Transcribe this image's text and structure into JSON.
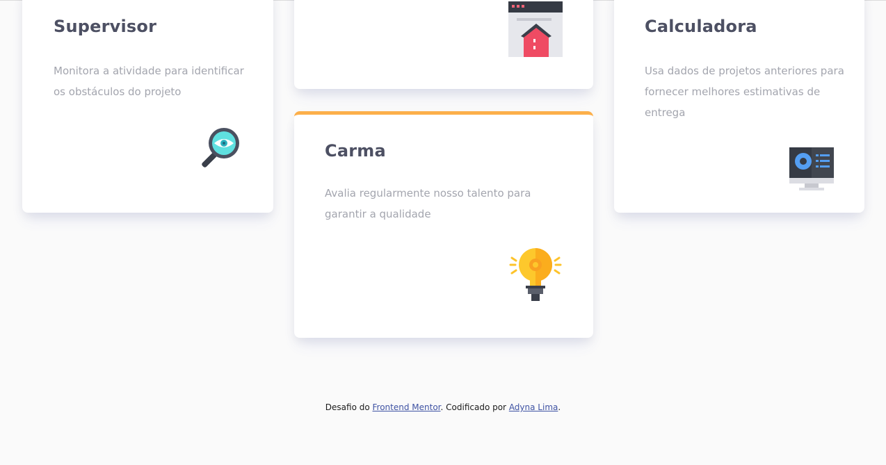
{
  "cards": {
    "supervisor": {
      "title": "Supervisor",
      "description": "Monitora a atividade para identificar os obstáculos do projeto",
      "icon": "magnifier-eye-icon",
      "accent": "#44d3d2"
    },
    "team_builder": {
      "icon": "team-builder-icon",
      "accent": "#ea5454"
    },
    "karma": {
      "title": "Carma",
      "description": "Avalia regularmente nosso talento para garantir a qualidade",
      "icon": "lightbulb-icon",
      "accent": "#fcaf4a"
    },
    "calculator": {
      "title": "Calculadora",
      "description": "Usa dados de projetos anteriores para fornecer melhores estimativas de entrega",
      "icon": "computer-monitor-icon",
      "accent": "#549ef2"
    }
  },
  "footer": {
    "prefix": "Desafio do ",
    "challenge_link": "Frontend Mentor",
    "middle": ". Codificado por ",
    "author_link": "Adyna Lima",
    "suffix": "."
  },
  "colors": {
    "background": "#fafafa",
    "title": "#4d5063",
    "description": "#a3a5ae",
    "link": "#3e52a3"
  }
}
